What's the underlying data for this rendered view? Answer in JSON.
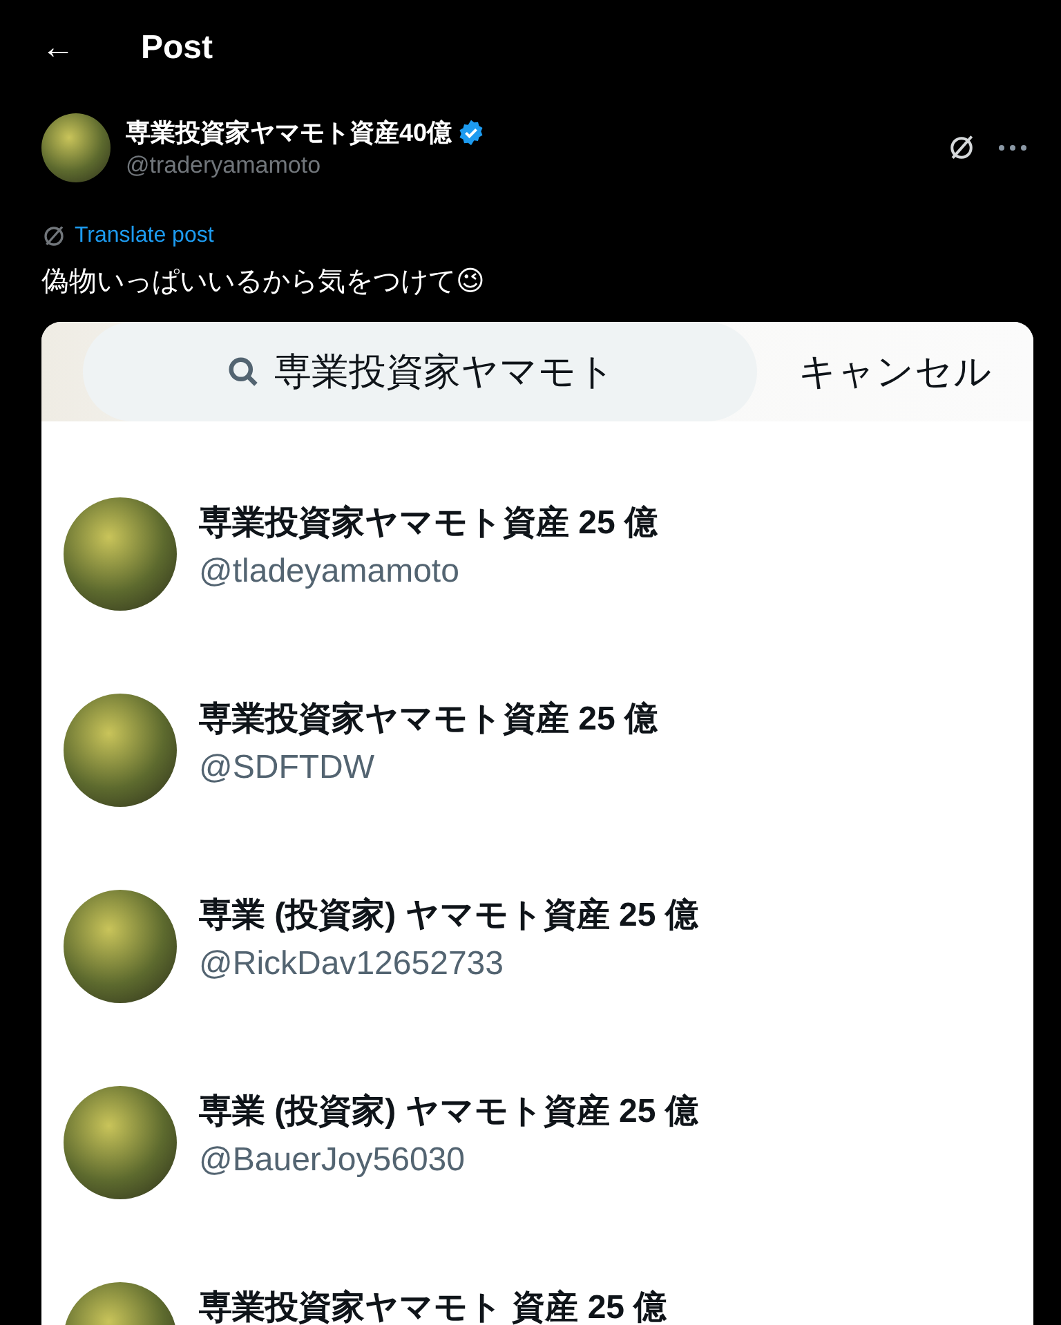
{
  "header": {
    "back_icon": "←",
    "title": "Post"
  },
  "post": {
    "author": {
      "name": "専業投資家ヤマモト資産40億",
      "verified": true,
      "handle": "@traderyamamoto"
    },
    "translate_label": "Translate post",
    "text": "偽物いっぱいいるから気をつけて😉",
    "screenshot": {
      "search": {
        "value": "専業投資家ヤマモト"
      },
      "cancel": "キャンセル",
      "results": [
        {
          "name": "専業投資家ヤマモト資産 25 億",
          "handle": "@tladeyamamoto"
        },
        {
          "name": "専業投資家ヤマモト資産 25 億",
          "handle": "@SDFTDW"
        },
        {
          "name": "専業 (投資家) ヤマモト資産 25 億",
          "handle": "@RickDav12652733"
        },
        {
          "name": "専業 (投資家) ヤマモト資産 25 億",
          "handle": "@BauerJoy56030"
        },
        {
          "name": "専業投資家ヤマモト 資産 25 億"
        }
      ]
    }
  }
}
